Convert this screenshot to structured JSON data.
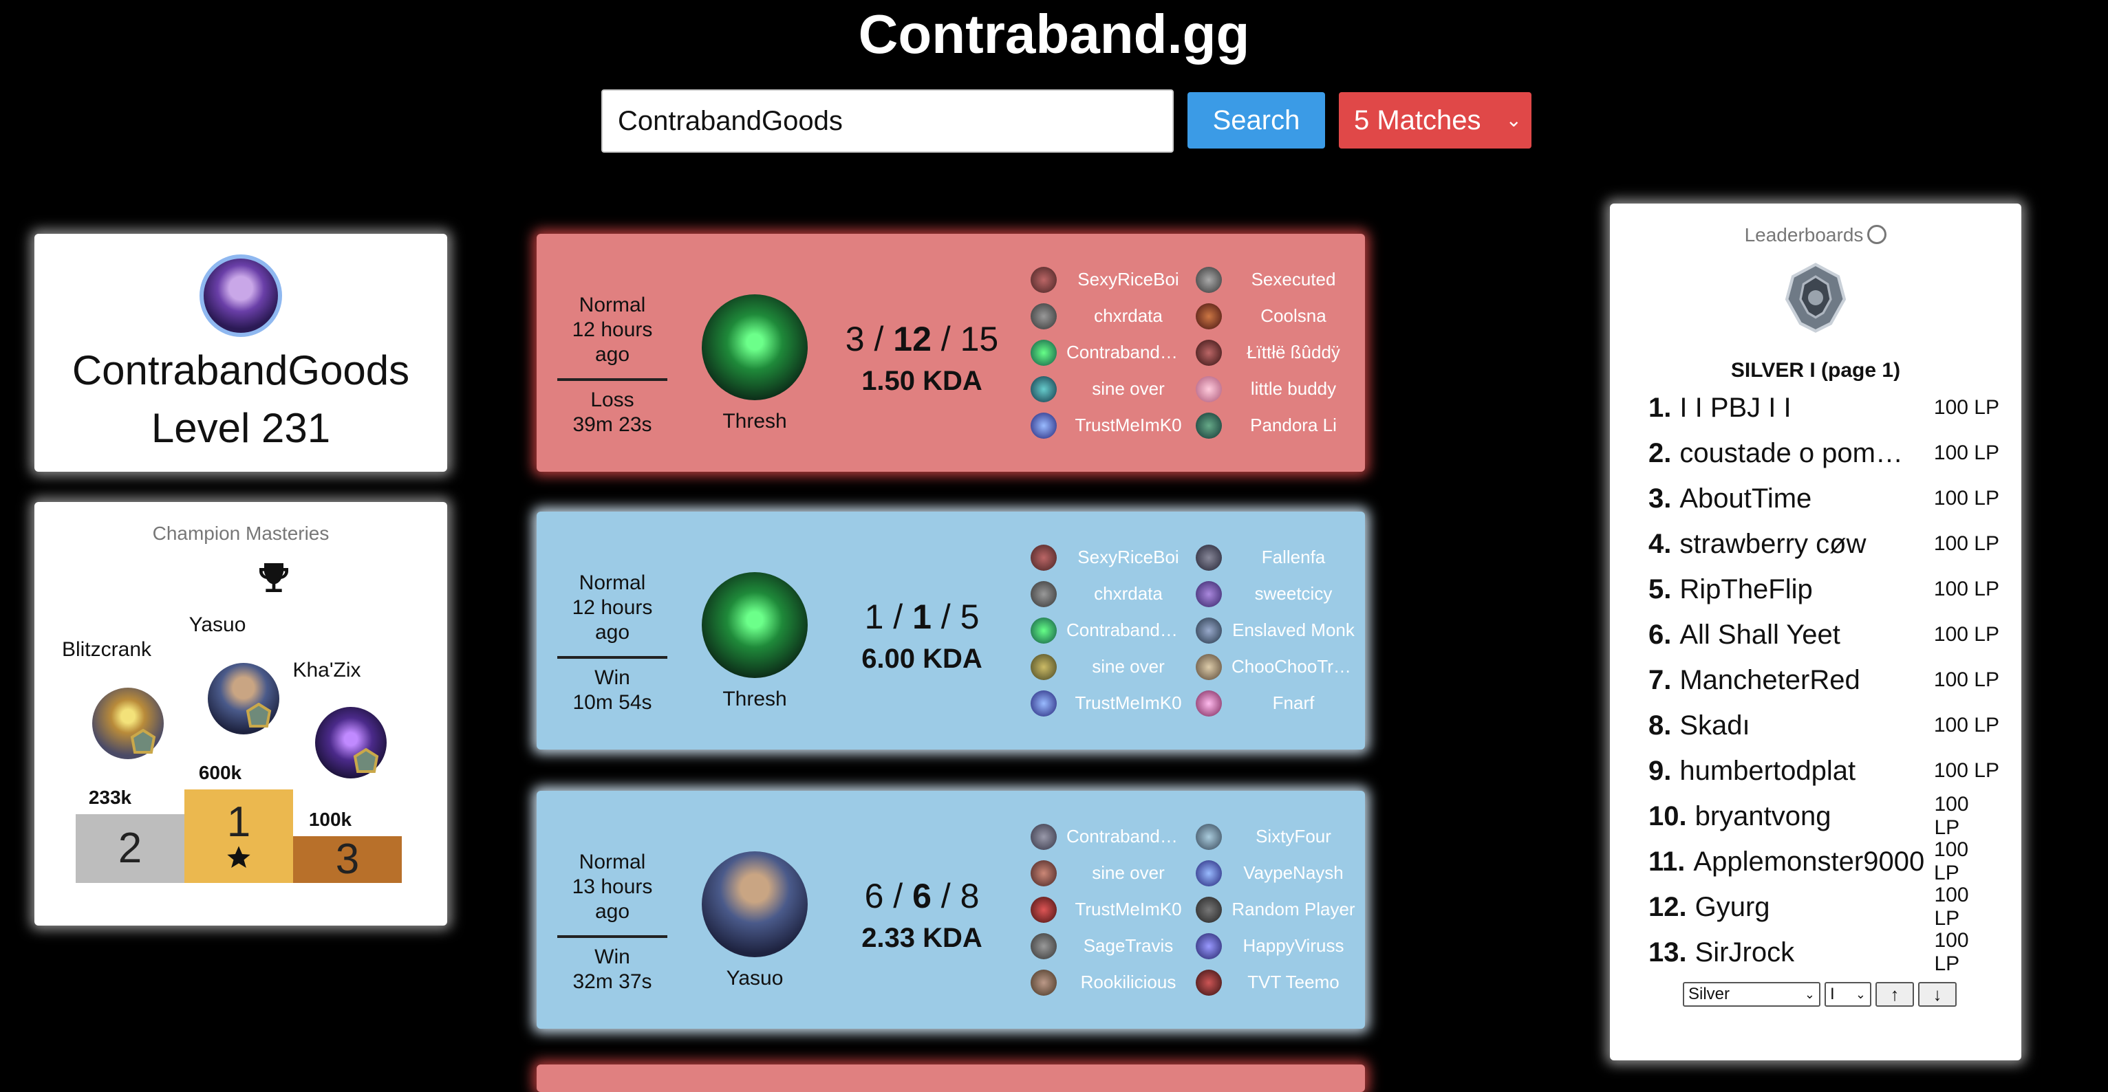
{
  "app": {
    "title": "Contraband.gg"
  },
  "search": {
    "value": "ContrabandGoods",
    "button_label": "Search",
    "matches_label": "5 Matches"
  },
  "profile": {
    "name": "ContrabandGoods",
    "level": "Level 231"
  },
  "masteries": {
    "title": "Champion Masteries",
    "first": {
      "champion": "Yasuo",
      "points": "600k",
      "rank": "1"
    },
    "second": {
      "champion": "Blitzcrank",
      "points": "233k",
      "rank": "2"
    },
    "third": {
      "champion": "Kha'Zix",
      "points": "100k",
      "rank": "3"
    },
    "colors": {
      "gold": "#ebb84f",
      "silver": "#bdbdbd",
      "bronze": "#b8702a"
    }
  },
  "matches": [
    {
      "result": "loss",
      "mode": "Normal",
      "when": "12 hours ago",
      "outcome": "Loss",
      "duration": "39m 23s",
      "champion": "Thresh",
      "kills": "3",
      "deaths": "12",
      "assists": "15",
      "kda": "1.50 KDA",
      "team1": [
        "SexyRiceBoi",
        "chxrdata",
        "ContrabandGoods",
        "sine over",
        "TrustMeImK0"
      ],
      "team2": [
        "Sexecuted",
        "Coolsna",
        "Łïttłë ßûddÿ",
        "little buddy",
        "Pandora Li"
      ]
    },
    {
      "result": "win",
      "mode": "Normal",
      "when": "12 hours ago",
      "outcome": "Win",
      "duration": "10m 54s",
      "champion": "Thresh",
      "kills": "1",
      "deaths": "1",
      "assists": "5",
      "kda": "6.00 KDA",
      "team1": [
        "SexyRiceBoi",
        "chxrdata",
        "ContrabandGoods",
        "sine over",
        "TrustMeImK0"
      ],
      "team2": [
        "Fallenfa",
        "sweetcicy",
        "Enslaved Monk",
        "ChooChooTrain",
        "Fnarf"
      ]
    },
    {
      "result": "win",
      "mode": "Normal",
      "when": "13 hours ago",
      "outcome": "Win",
      "duration": "32m 37s",
      "champion": "Yasuo",
      "kills": "6",
      "deaths": "6",
      "assists": "8",
      "kda": "2.33 KDA",
      "team1": [
        "ContrabandGoods",
        "sine over",
        "TrustMeImK0",
        "SageTravis",
        "Rookilicious"
      ],
      "team2": [
        "SixtyFour",
        "VaypeNaysh",
        "Random Player",
        "HappyViruss",
        "TVT Teemo"
      ]
    }
  ],
  "leaderboard": {
    "title": "Leaderboards",
    "rank_title": "SILVER I (page 1)",
    "entries": [
      {
        "n": "1.",
        "name": "I I PBJ I I",
        "lp": "100 LP"
      },
      {
        "n": "2.",
        "name": "coustade o pommes",
        "lp": "100 LP"
      },
      {
        "n": "3.",
        "name": "AboutTime",
        "lp": "100 LP"
      },
      {
        "n": "4.",
        "name": "strawberry cøw",
        "lp": "100 LP"
      },
      {
        "n": "5.",
        "name": "RipTheFlip",
        "lp": "100 LP"
      },
      {
        "n": "6.",
        "name": "All Shall Yeet",
        "lp": "100 LP"
      },
      {
        "n": "7.",
        "name": "MancheterRed",
        "lp": "100 LP"
      },
      {
        "n": "8.",
        "name": "Skadı",
        "lp": "100 LP"
      },
      {
        "n": "9.",
        "name": "humbertodplat",
        "lp": "100 LP"
      },
      {
        "n": "10.",
        "name": "bryantvong",
        "lp": "100 LP"
      },
      {
        "n": "11.",
        "name": "Applemonster9000",
        "lp": "100 LP"
      },
      {
        "n": "12.",
        "name": "Gyurg",
        "lp": "100 LP"
      },
      {
        "n": "13.",
        "name": "SirJrock",
        "lp": "100 LP"
      }
    ],
    "tier_select": "Silver",
    "division_select": "I"
  },
  "icons": {
    "trophy": "trophy-icon",
    "star": "star-icon",
    "user": "user-circle-icon",
    "up": "arrow-up-icon",
    "down": "arrow-down-icon",
    "chevron": "chevron-down-icon"
  }
}
